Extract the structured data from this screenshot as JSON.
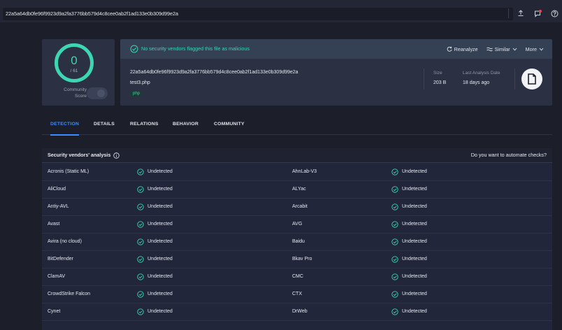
{
  "search": {
    "value": "22a5a64db0fe96f9923d9a2fa3776bb579d4c8cee0ab2f1ad133e0b309d99e2a"
  },
  "topbar_icons": [
    "upload-icon",
    "notifications-icon",
    "help-icon"
  ],
  "score": {
    "value": "0",
    "total": "/ 61",
    "community_label_line1": "Community",
    "community_label_line2": "Score"
  },
  "banner": {
    "text": "No security vendors flagged this file as malicious",
    "reanalyze": "Reanalyze",
    "similar": "Similar",
    "more": "More"
  },
  "file": {
    "hash": "22a5a64db0fe96f9923d9a2fa3776bb579d4c8cee0ab2f1ad133e0b309d99e2a",
    "name": "test3.php",
    "tag": "php",
    "size_label": "Size",
    "size_value": "203 B",
    "last_label": "Last Analysis Date",
    "last_value": "18 days ago"
  },
  "tabs": [
    "DETECTION",
    "DETAILS",
    "RELATIONS",
    "BEHAVIOR",
    "COMMUNITY"
  ],
  "table": {
    "title": "Security vendors' analysis",
    "automate": "Do you want to automate checks?",
    "rows": [
      {
        "v1": "Acronis (Static ML)",
        "r1": "Undetected",
        "v2": "AhnLab-V3",
        "r2": "Undetected"
      },
      {
        "v1": "AliCloud",
        "r1": "Undetected",
        "v2": "ALYac",
        "r2": "Undetected"
      },
      {
        "v1": "Antiy-AVL",
        "r1": "Undetected",
        "v2": "Arcabit",
        "r2": "Undetected"
      },
      {
        "v1": "Avast",
        "r1": "Undetected",
        "v2": "AVG",
        "r2": "Undetected"
      },
      {
        "v1": "Avira (no cloud)",
        "r1": "Undetected",
        "v2": "Baidu",
        "r2": "Undetected"
      },
      {
        "v1": "BitDefender",
        "r1": "Undetected",
        "v2": "Bkav Pro",
        "r2": "Undetected"
      },
      {
        "v1": "ClamAV",
        "r1": "Undetected",
        "v2": "CMC",
        "r2": "Undetected"
      },
      {
        "v1": "CrowdStrike Falcon",
        "r1": "Undetected",
        "v2": "CTX",
        "r2": "Undetected"
      },
      {
        "v1": "Cynet",
        "r1": "Undetected",
        "v2": "DrWeb",
        "r2": "Undetected"
      }
    ]
  },
  "colors": {
    "accent": "#3bd6b2",
    "tab_active": "#3b8cff",
    "background": "#1c1f2a"
  }
}
